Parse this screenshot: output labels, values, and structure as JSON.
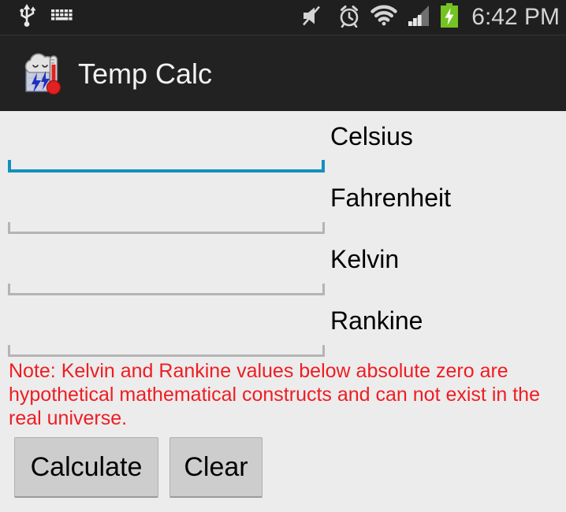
{
  "status_bar": {
    "clock": "6:42 PM",
    "background_color": "#1f1f1f",
    "icon_color": "#d4d4d4",
    "left_icons": [
      {
        "name": "usb-icon",
        "label": "USB connected"
      },
      {
        "name": "keyboard-icon",
        "label": "Keyboard active"
      }
    ],
    "right_icons": [
      {
        "name": "volume-mute-icon",
        "label": "Sound muted"
      },
      {
        "name": "alarm-clock-icon",
        "label": "Alarm set"
      },
      {
        "name": "wifi-icon",
        "label": "Wi-Fi connected"
      },
      {
        "name": "cellular-signal-icon",
        "label": "Cellular signal"
      },
      {
        "name": "battery-charging-icon",
        "label": "Battery charging",
        "color": "#74c322"
      }
    ]
  },
  "action_bar": {
    "title": "Temp Calc",
    "background_color": "#222222",
    "title_color": "#f2f2f2",
    "icon_name": "cloud-lightning-thermometer-icon"
  },
  "main": {
    "background_color": "#ececec",
    "fields": [
      {
        "label": "Celsius",
        "value": "",
        "placeholder": "",
        "focused": true,
        "underline_color": "#1490bd"
      },
      {
        "label": "Fahrenheit",
        "value": "",
        "placeholder": "",
        "focused": false,
        "underline_color": "#b4b4b4"
      },
      {
        "label": "Kelvin",
        "value": "",
        "placeholder": "",
        "focused": false,
        "underline_color": "#b4b4b4"
      },
      {
        "label": "Rankine",
        "value": "",
        "placeholder": "",
        "focused": false,
        "underline_color": "#b4b4b4"
      }
    ],
    "note": "Note: Kelvin and Rankine values below absolute zero are hypothetical mathematical constructs and can not exist in the real universe.",
    "note_color": "#ee1d23",
    "buttons": {
      "calculate_label": "Calculate",
      "clear_label": "Clear"
    }
  }
}
